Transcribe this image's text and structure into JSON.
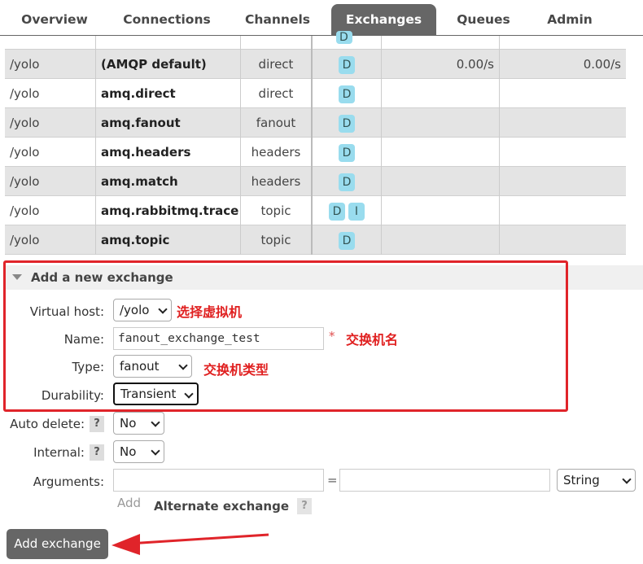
{
  "nav": {
    "tabs": [
      {
        "label": "Overview",
        "active": false
      },
      {
        "label": "Connections",
        "active": false
      },
      {
        "label": "Channels",
        "active": false
      },
      {
        "label": "Exchanges",
        "active": true
      },
      {
        "label": "Queues",
        "active": false
      },
      {
        "label": "Admin",
        "active": false
      }
    ]
  },
  "exchanges": {
    "top_row_feature": "D",
    "rows": [
      {
        "vhost": "/yolo",
        "name": "(AMQP default)",
        "type": "direct",
        "features": [
          "D"
        ],
        "message_rate_in": "0.00/s",
        "message_rate_out": "0.00/s"
      },
      {
        "vhost": "/yolo",
        "name": "amq.direct",
        "type": "direct",
        "features": [
          "D"
        ],
        "message_rate_in": "",
        "message_rate_out": ""
      },
      {
        "vhost": "/yolo",
        "name": "amq.fanout",
        "type": "fanout",
        "features": [
          "D"
        ],
        "message_rate_in": "",
        "message_rate_out": ""
      },
      {
        "vhost": "/yolo",
        "name": "amq.headers",
        "type": "headers",
        "features": [
          "D"
        ],
        "message_rate_in": "",
        "message_rate_out": ""
      },
      {
        "vhost": "/yolo",
        "name": "amq.match",
        "type": "headers",
        "features": [
          "D"
        ],
        "message_rate_in": "",
        "message_rate_out": ""
      },
      {
        "vhost": "/yolo",
        "name": "amq.rabbitmq.trace",
        "type": "topic",
        "features": [
          "D",
          "I"
        ],
        "message_rate_in": "",
        "message_rate_out": ""
      },
      {
        "vhost": "/yolo",
        "name": "amq.topic",
        "type": "topic",
        "features": [
          "D"
        ],
        "message_rate_in": "",
        "message_rate_out": ""
      }
    ]
  },
  "add_exchange": {
    "section_title": "Add a new exchange",
    "virtual_host": {
      "label": "Virtual host:",
      "value": "/yolo"
    },
    "name": {
      "label": "Name:",
      "value": "fanout_exchange_test",
      "required_mark": "*"
    },
    "type": {
      "label": "Type:",
      "value": "fanout"
    },
    "durability": {
      "label": "Durability:",
      "value": "Transient"
    },
    "auto_delete": {
      "label": "Auto delete:",
      "help": "?",
      "value": "No"
    },
    "internal": {
      "label": "Internal:",
      "help": "?",
      "value": "No"
    },
    "arguments": {
      "label": "Arguments:",
      "key_value": "",
      "equals": "=",
      "value_value": "",
      "type_value": "String"
    },
    "add_link": "Add",
    "alternate_exchange": {
      "label": "Alternate exchange",
      "help": "?"
    },
    "submit_label": "Add exchange"
  },
  "annotations": {
    "virtual_host_note": "选择虚拟机",
    "name_note": "交换机名",
    "type_note": "交换机类型",
    "color": "#e0242a"
  }
}
